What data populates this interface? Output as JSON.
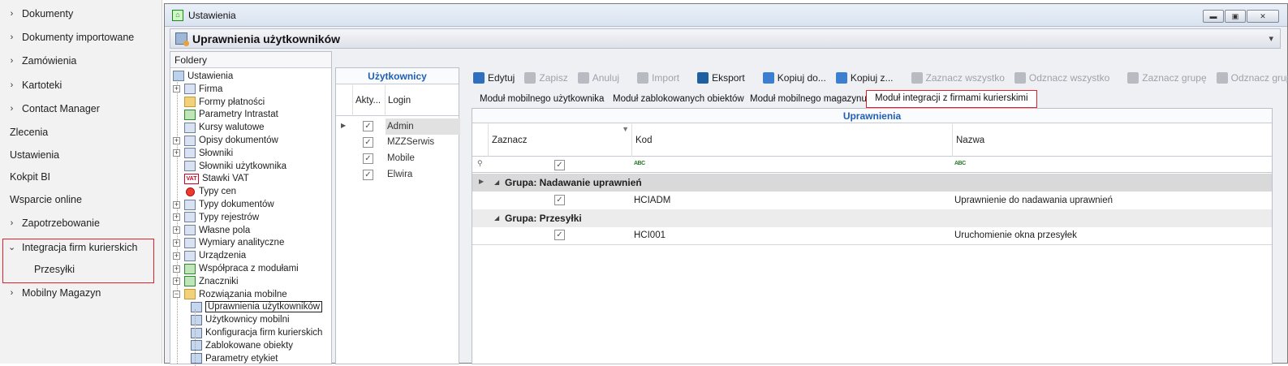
{
  "nav": {
    "items": [
      {
        "label": "Dokumenty",
        "chevron": true
      },
      {
        "label": "Dokumenty importowane",
        "chevron": true
      },
      {
        "label": "Zamówienia",
        "chevron": true
      },
      {
        "label": "Kartoteki",
        "chevron": true
      },
      {
        "label": "Contact Manager",
        "chevron": true
      },
      {
        "label": "Zlecenia",
        "chevron": false
      },
      {
        "label": "Ustawienia",
        "chevron": false
      },
      {
        "label": "Kokpit BI",
        "chevron": false
      },
      {
        "label": "Wsparcie online",
        "chevron": false
      },
      {
        "label": "Zapotrzebowanie",
        "chevron": true
      },
      {
        "label": "Integracja firm kurierskich",
        "chevron": true,
        "expanded": true
      },
      {
        "label": "Przesyłki",
        "sub": true
      },
      {
        "label": "Mobilny Magazyn",
        "chevron": true
      }
    ]
  },
  "window": {
    "title": "Ustawienia",
    "subtitle": "Uprawnienia użytkowników"
  },
  "folders": {
    "header": "Foldery",
    "root": "Ustawienia",
    "items": [
      {
        "label": "Firma",
        "expand": true,
        "icon": "table"
      },
      {
        "label": "Formy płatności",
        "expand": false,
        "icon": "folder"
      },
      {
        "label": "Parametry Intrastat",
        "expand": false,
        "icon": "green"
      },
      {
        "label": "Kursy walutowe",
        "expand": false,
        "icon": "chart"
      },
      {
        "label": "Opisy dokumentów",
        "expand": true,
        "icon": "doc"
      },
      {
        "label": "Słowniki",
        "expand": true,
        "icon": "doc"
      },
      {
        "label": "Słowniki użytkownika",
        "expand": false,
        "icon": "doc"
      },
      {
        "label": "Stawki VAT",
        "expand": false,
        "icon": "vat"
      },
      {
        "label": "Typy cen",
        "expand": false,
        "icon": "red"
      },
      {
        "label": "Typy dokumentów",
        "expand": true,
        "icon": "doc"
      },
      {
        "label": "Typy rejestrów",
        "expand": true,
        "icon": "table"
      },
      {
        "label": "Własne pola",
        "expand": true,
        "icon": "doc"
      },
      {
        "label": "Wymiary analityczne",
        "expand": true,
        "icon": "doc"
      },
      {
        "label": "Urządzenia",
        "expand": true,
        "icon": "printer"
      },
      {
        "label": "Współpraca z modułami",
        "expand": true,
        "icon": "green"
      },
      {
        "label": "Znaczniki",
        "expand": true,
        "icon": "green"
      },
      {
        "label": "Rozwiązania mobilne",
        "expand": true,
        "expanded": true,
        "icon": "folder"
      },
      {
        "label": "Uprawnienia użytkowników",
        "child": true,
        "selected": true,
        "icon": "user"
      },
      {
        "label": "Użytkownicy mobilni",
        "child": true,
        "icon": "user"
      },
      {
        "label": "Konfiguracja firm kurierskich",
        "child": true,
        "icon": "user"
      },
      {
        "label": "Zablokowane obiekty",
        "child": true,
        "icon": "user"
      },
      {
        "label": "Parametry etykiet",
        "child": true,
        "icon": "user"
      }
    ]
  },
  "users": {
    "caption": "Użytkownicy",
    "columns": [
      "Akty...",
      "Login"
    ],
    "rows": [
      {
        "active": "✓",
        "login": "Admin",
        "selected": true
      },
      {
        "active": "✓",
        "login": "MZZSerwis"
      },
      {
        "active": "✓",
        "login": "Mobile"
      },
      {
        "active": "✓",
        "login": "Elwira"
      }
    ]
  },
  "toolbar": {
    "buttons": [
      {
        "label": "Edytuj",
        "enabled": true,
        "icon": "pencil-icon",
        "color": "#2f6fc0"
      },
      {
        "label": "Zapisz",
        "enabled": false,
        "icon": "save-icon",
        "color": "#b8bcc2"
      },
      {
        "label": "Anuluj",
        "enabled": false,
        "icon": "undo-icon",
        "color": "#b8bcc2"
      },
      {
        "label": "Import",
        "enabled": false,
        "icon": "folder-open-icon",
        "color": "#b8bcc2"
      },
      {
        "label": "Eksport",
        "enabled": true,
        "icon": "folder-icon",
        "color": "#1f5fa0"
      },
      {
        "label": "Kopiuj do...",
        "enabled": true,
        "icon": "copy-to-icon",
        "color": "#3a7fd0"
      },
      {
        "label": "Kopiuj z...",
        "enabled": true,
        "icon": "copy-from-icon",
        "color": "#3a7fd0"
      },
      {
        "label": "Zaznacz wszystko",
        "enabled": false,
        "icon": "check-circle-icon",
        "color": "#b8bcc2"
      },
      {
        "label": "Odznacz wszystko",
        "enabled": false,
        "icon": "x-circle-icon",
        "color": "#b8bcc2"
      },
      {
        "label": "Zaznacz grupę",
        "enabled": false,
        "icon": "check-list-icon",
        "color": "#b8bcc2"
      },
      {
        "label": "Odznacz grupę",
        "enabled": false,
        "icon": "list-icon",
        "color": "#b8bcc2"
      }
    ]
  },
  "tabs": [
    {
      "label": "Moduł mobilnego użytkownika"
    },
    {
      "label": "Moduł zablokowanych obiektów"
    },
    {
      "label": "Moduł mobilnego magazynu"
    },
    {
      "label": "Moduł integracji z firmami kurierskimi",
      "active": true
    }
  ],
  "permissions": {
    "caption": "Uprawnienia",
    "columns": {
      "zaznacz": "Zaznacz",
      "kod": "Kod",
      "nazwa": "Nazwa"
    },
    "filter_glyph": "ABC",
    "groups": [
      {
        "title": "Grupa: Nadawanie uprawnień",
        "rows": [
          {
            "checked": "✓",
            "kod": "HCIADM",
            "nazwa": "Uprawnienie do nadawania uprawnień"
          }
        ]
      },
      {
        "title": "Grupa: Przesyłki",
        "rows": [
          {
            "checked": "✓",
            "kod": "HCI001",
            "nazwa": "Uruchomienie okna przesyłek"
          }
        ]
      }
    ]
  }
}
